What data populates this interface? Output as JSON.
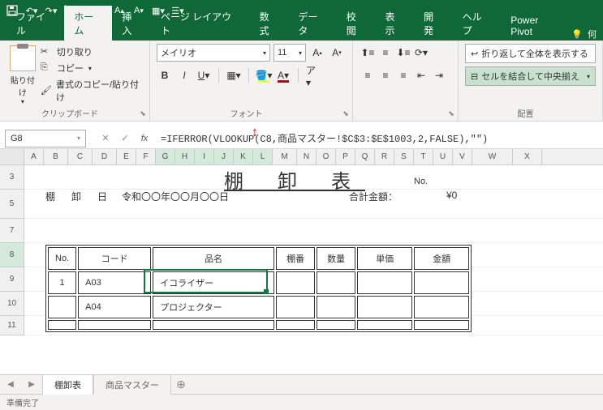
{
  "qat": {
    "save": "保存",
    "undo": "元に戻す",
    "redo": "やり直し"
  },
  "tabs": {
    "file": "ファイル",
    "home": "ホーム",
    "insert": "挿入",
    "pagelayout": "ページ レイアウト",
    "formulas": "数式",
    "data": "データ",
    "review": "校閲",
    "view": "表示",
    "developer": "開発",
    "help": "ヘルプ",
    "powerpivot": "Power Pivot",
    "tell": "何"
  },
  "ribbon": {
    "clipboard": {
      "paste": "貼り付け",
      "cut": "切り取り",
      "copy": "コピー",
      "formatpainter": "書式のコピー/貼り付け",
      "label": "クリップボード"
    },
    "font": {
      "name": "メイリオ",
      "size": "11",
      "label": "フォント"
    },
    "align": {
      "label": "配置"
    },
    "wrap": {
      "wraptext": "折り返して全体を表示する",
      "merge": "セルを結合して中央揃え"
    }
  },
  "namebox": "G8",
  "formula": "=IFERROR(VLOOKUP(C8,商品マスター!$C$3:$E$1003,2,FALSE),\"\")",
  "cols": [
    "A",
    "B",
    "C",
    "D",
    "E",
    "F",
    "G",
    "H",
    "I",
    "J",
    "K",
    "L",
    "M",
    "N",
    "O",
    "P",
    "Q",
    "R",
    "S",
    "T",
    "U",
    "V",
    "W",
    "X"
  ],
  "rows": [
    "3",
    "5",
    "7",
    "8",
    "9",
    "10",
    "11"
  ],
  "doc": {
    "title": "棚 卸 表",
    "no_label": "No.",
    "date_label": "棚　卸　日　：",
    "date_value": "令和〇〇年〇〇月〇〇日",
    "total_label": "合計金額：",
    "total_value": "¥0",
    "headers": {
      "no": "No.",
      "code": "コード",
      "name": "品名",
      "shelf": "棚番",
      "qty": "数量",
      "unit": "単価",
      "amount": "金額"
    },
    "rows": [
      {
        "no": "1",
        "code": "A03",
        "name": "イコライザー"
      },
      {
        "no": "",
        "code": "A04",
        "name": "プロジェクター"
      },
      {
        "no": "",
        "code": "",
        "name": ""
      }
    ]
  },
  "sheets": {
    "active": "棚卸表",
    "other": "商品マスター"
  },
  "status": "準備完了"
}
